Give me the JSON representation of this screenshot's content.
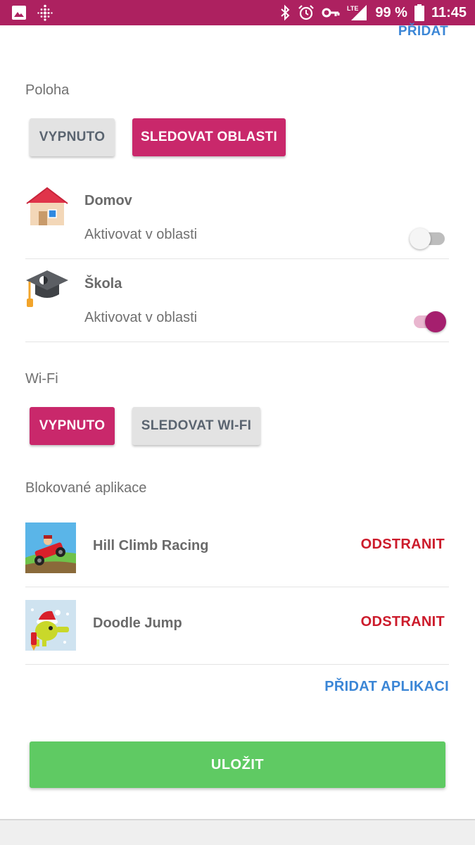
{
  "status_bar": {
    "battery": "99 %",
    "time": "11:45",
    "network": "LTE",
    "color": "#ad2160",
    "icons_left": [
      "image-icon",
      "fitbit-icon"
    ],
    "icons_right": [
      "bluetooth-icon",
      "alarm-icon",
      "vpn-key-icon",
      "lte-signal-icon",
      "battery-icon"
    ]
  },
  "top_link": "PŘIDAT",
  "location": {
    "label": "Poloha",
    "off_button": "VYPNUTO",
    "track_button": "SLEDOVAT OBLASTI",
    "selected": "SLEDOVAT OBLASTI",
    "zones": [
      {
        "name": "Domov",
        "subtitle": "Aktivovat v oblasti",
        "icon": "house-icon",
        "enabled": false
      },
      {
        "name": "Škola",
        "subtitle": "Aktivovat v oblasti",
        "icon": "graduation-cap-icon",
        "enabled": true
      }
    ]
  },
  "wifi": {
    "label": "Wi-Fi",
    "off_button": "VYPNUTO",
    "track_button": "SLEDOVAT WI-FI",
    "selected": "VYPNUTO"
  },
  "blocked_apps": {
    "label": "Blokované aplikace",
    "apps": [
      {
        "name": "Hill Climb Racing",
        "action": "ODSTRANIT",
        "icon": "hill-climb-racing-icon"
      },
      {
        "name": "Doodle Jump",
        "action": "ODSTRANIT",
        "icon": "doodle-jump-icon"
      }
    ],
    "add_label": "PŘIDAT APLIKACI"
  },
  "save_label": "ULOŽIT",
  "colors": {
    "accent": "#c9286b",
    "link": "#3b86d6",
    "remove": "#cc1b2b",
    "save": "#5fca63"
  }
}
